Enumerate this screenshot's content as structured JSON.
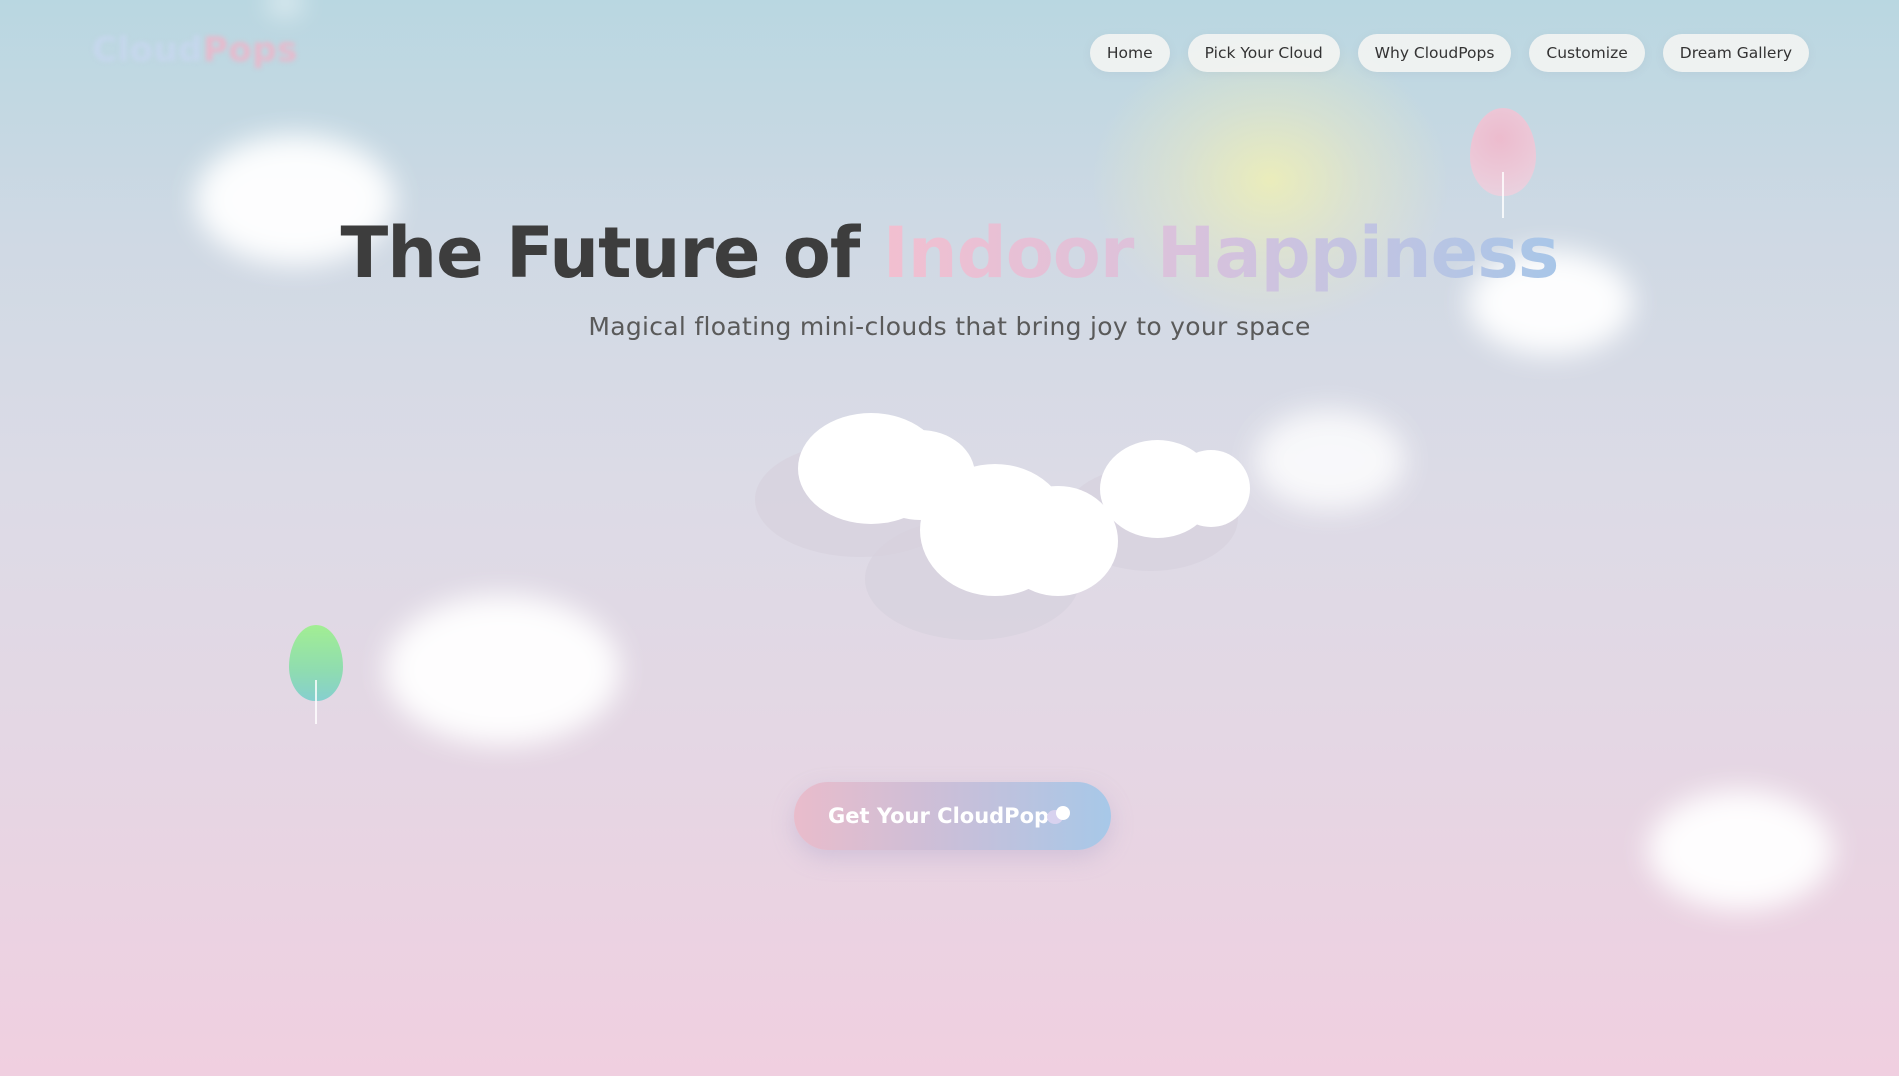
{
  "brand": {
    "logo_part1": "Cloud",
    "logo_part2": "Pops"
  },
  "nav": {
    "items": [
      {
        "label": "Home"
      },
      {
        "label": "Pick Your Cloud"
      },
      {
        "label": "Why CloudPops"
      },
      {
        "label": "Customize"
      },
      {
        "label": "Dream Gallery"
      }
    ]
  },
  "hero": {
    "title_plain": "The Future of",
    "title_highlight": "Indoor Happiness",
    "subtitle": "Magical floating mini-clouds that bring joy to your space"
  },
  "cta": {
    "label": "Get Your CloudPop",
    "icon": "cloud-icon"
  },
  "colors": {
    "title_text": "#3d3d3d",
    "gradient_pink": "#f2bfd0",
    "gradient_lavender": "#d9c2dc",
    "gradient_blue": "#a8c6e8",
    "background_top": "#b9d7e1",
    "background_bottom": "#f0cfe0",
    "balloon_pink": "#f4c3d5",
    "balloon_green": "#9be39a"
  }
}
